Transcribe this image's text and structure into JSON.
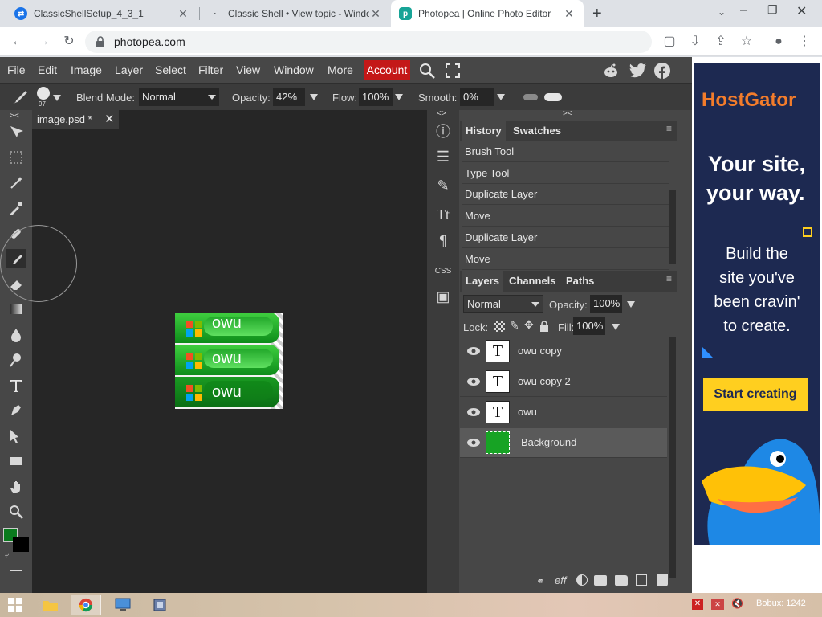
{
  "browser": {
    "tabs": [
      {
        "title": "ClassicShellSetup_4_3_1"
      },
      {
        "title": "Classic Shell • View topic - Windo"
      },
      {
        "title": "Photopea | Online Photo Editor"
      }
    ],
    "url": "photopea.com"
  },
  "app": {
    "menu": [
      "File",
      "Edit",
      "Image",
      "Layer",
      "Select",
      "Filter",
      "View",
      "Window",
      "More"
    ],
    "account_label": "Account",
    "options": {
      "brush_size": "97",
      "blend_mode_label": "Blend Mode:",
      "blend_mode_value": "Normal",
      "opacity_label": "Opacity:",
      "opacity_value": "42%",
      "flow_label": "Flow:",
      "flow_value": "100%",
      "smooth_label": "Smooth:",
      "smooth_value": "0%"
    },
    "document": {
      "tab_title": "image.psd *",
      "buttons": [
        "owu",
        "owu",
        "owu"
      ]
    },
    "history_panel": {
      "tabs": [
        "History",
        "Swatches"
      ],
      "items": [
        "Brush Tool",
        "Type Tool",
        "Duplicate Layer",
        "Move",
        "Duplicate Layer",
        "Move"
      ]
    },
    "layers_panel": {
      "tabs": [
        "Layers",
        "Channels",
        "Paths"
      ],
      "blend_mode": "Normal",
      "opacity_label": "Opacity:",
      "opacity_value": "100%",
      "lock_label": "Lock:",
      "fill_label": "Fill:",
      "fill_value": "100%",
      "layers": [
        {
          "name": "owu copy",
          "thumb": "T"
        },
        {
          "name": "owu copy 2",
          "thumb": "T"
        },
        {
          "name": "owu",
          "thumb": "T"
        },
        {
          "name": "Background",
          "thumb": ""
        }
      ],
      "footer_eff": "eff",
      "footer_css": "CSS"
    },
    "colors": {
      "foreground": "#0a7a1e",
      "background": "#000000",
      "accent": "#c41818"
    }
  },
  "ad": {
    "brand": "HostGator",
    "headline_1": "Your site,",
    "headline_2": "your way.",
    "body_1": "Build the",
    "body_2": "site you've",
    "body_3": "been cravin'",
    "body_4": "to create.",
    "cta": "Start creating"
  },
  "taskbar": {
    "status": "Bobux: 1242"
  }
}
